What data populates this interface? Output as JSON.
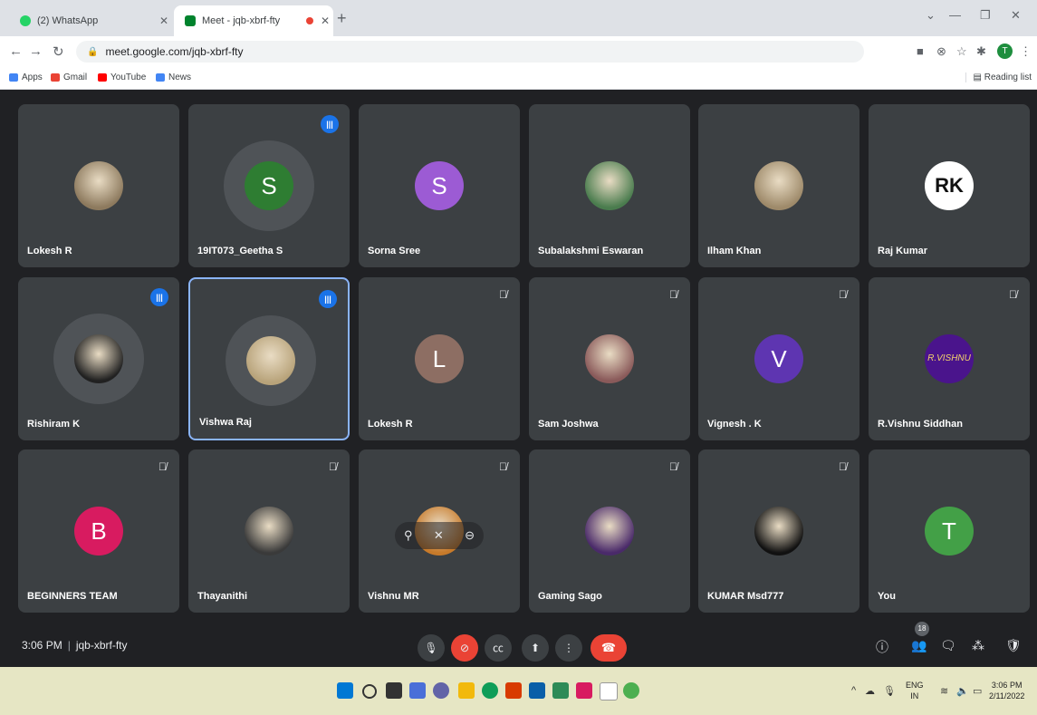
{
  "browser": {
    "tabs": [
      {
        "title": "(2) WhatsApp",
        "icon": "whatsapp-icon",
        "color": "#25d366"
      },
      {
        "title": "Meet - jqb-xbrf-fty",
        "icon": "meet-icon",
        "color": "#00832d"
      }
    ],
    "url": "meet.google.com/jqb-xbrf-fty",
    "bookmarks": [
      {
        "label": "Apps",
        "icon": "apps-grid-icon",
        "color": "#4285f4"
      },
      {
        "label": "Gmail",
        "icon": "gmail-icon",
        "color": "#ea4335"
      },
      {
        "label": "YouTube",
        "icon": "youtube-icon",
        "color": "#ff0000"
      },
      {
        "label": "News",
        "icon": "news-icon",
        "color": "#4285f4"
      }
    ],
    "reading_list": "Reading list",
    "profile_initial": "T"
  },
  "participants": [
    {
      "name": "Lokesh R",
      "avatar": "photo",
      "color": "#8d7a5e",
      "status": "none"
    },
    {
      "name": "19IT073_Geetha S",
      "avatar": "S",
      "color": "#2e7d32",
      "status": "speaking"
    },
    {
      "name": "Sorna Sree",
      "avatar": "S",
      "color": "#9c5bd4",
      "status": "none"
    },
    {
      "name": "Subalakshmi Eswaran",
      "avatar": "photo",
      "color": "#4a7c4e",
      "status": "none"
    },
    {
      "name": "Ilham Khan",
      "avatar": "photo",
      "color": "#9e8a6a",
      "status": "none"
    },
    {
      "name": "Raj Kumar",
      "avatar": "RK",
      "color": "#ffffff",
      "status": "none"
    },
    {
      "name": "Rishiram K",
      "avatar": "photo",
      "color": "#212121",
      "status": "speaking"
    },
    {
      "name": "Vishwa Raj",
      "avatar": "photo",
      "color": "#b8a37a",
      "status": "speaking",
      "highlight": true
    },
    {
      "name": "Lokesh R",
      "avatar": "L",
      "color": "#8d6e63",
      "status": "muted"
    },
    {
      "name": "Sam Joshwa",
      "avatar": "photo",
      "color": "#8a5a5a",
      "status": "muted"
    },
    {
      "name": "Vignesh . K",
      "avatar": "V",
      "color": "#5e35b1",
      "status": "muted"
    },
    {
      "name": "R.Vishnu Siddhan",
      "avatar": "R.VISHNU",
      "color": "#4a148c",
      "status": "muted"
    },
    {
      "name": "BEGINNERS TEAM",
      "avatar": "B",
      "color": "#d81b60",
      "status": "muted"
    },
    {
      "name": "Thayanithi",
      "avatar": "photo",
      "color": "#3a3a3a",
      "status": "muted"
    },
    {
      "name": "Vishnu MR",
      "avatar": "photo",
      "color": "#c77a2a",
      "status": "muted",
      "hover_controls": true
    },
    {
      "name": "Gaming Sago",
      "avatar": "photo",
      "color": "#4a2a6a",
      "status": "muted"
    },
    {
      "name": "KUMAR Msd777",
      "avatar": "photo",
      "color": "#111111",
      "status": "muted"
    },
    {
      "name": "You",
      "avatar": "T",
      "color": "#43a047",
      "status": "none"
    }
  ],
  "meeting": {
    "time": "3:06 PM",
    "code": "jqb-xbrf-fty",
    "participant_count": "18"
  },
  "taskbar": {
    "lang": "ENG",
    "region": "IN",
    "time": "3:06 PM",
    "date": "2/11/2022"
  }
}
